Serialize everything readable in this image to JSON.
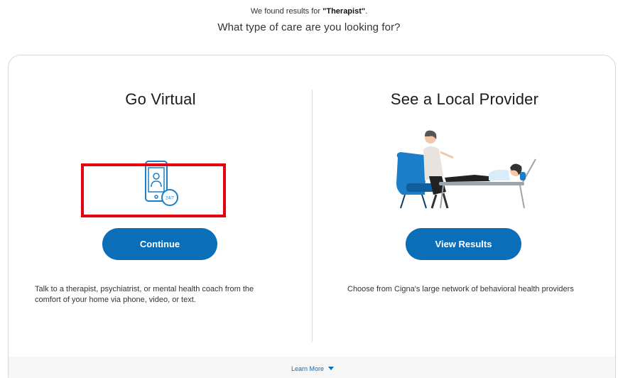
{
  "intro": {
    "prefix": "We found results for ",
    "query": "\"Therapist\"",
    "suffix": "."
  },
  "question": "What type of care are you looking for?",
  "virtual": {
    "title": "Go Virtual",
    "button_label": "Continue",
    "description": "Talk to a therapist, psychiatrist, or mental health coach from the comfort of your home via phone, video, or text.",
    "icon": "phone-video-24-7-icon"
  },
  "local": {
    "title": "See a Local Provider",
    "button_label": "View Results",
    "description": "Choose from Cigna's large network of behavioral health providers",
    "illustration": "therapy-session-illustration"
  },
  "footer": {
    "learn_more": "Learn More"
  },
  "icon_badge": "24/7",
  "colors": {
    "primary": "#0a6eb8",
    "highlight": "#e3000f",
    "chair": "#1a7ec8"
  }
}
